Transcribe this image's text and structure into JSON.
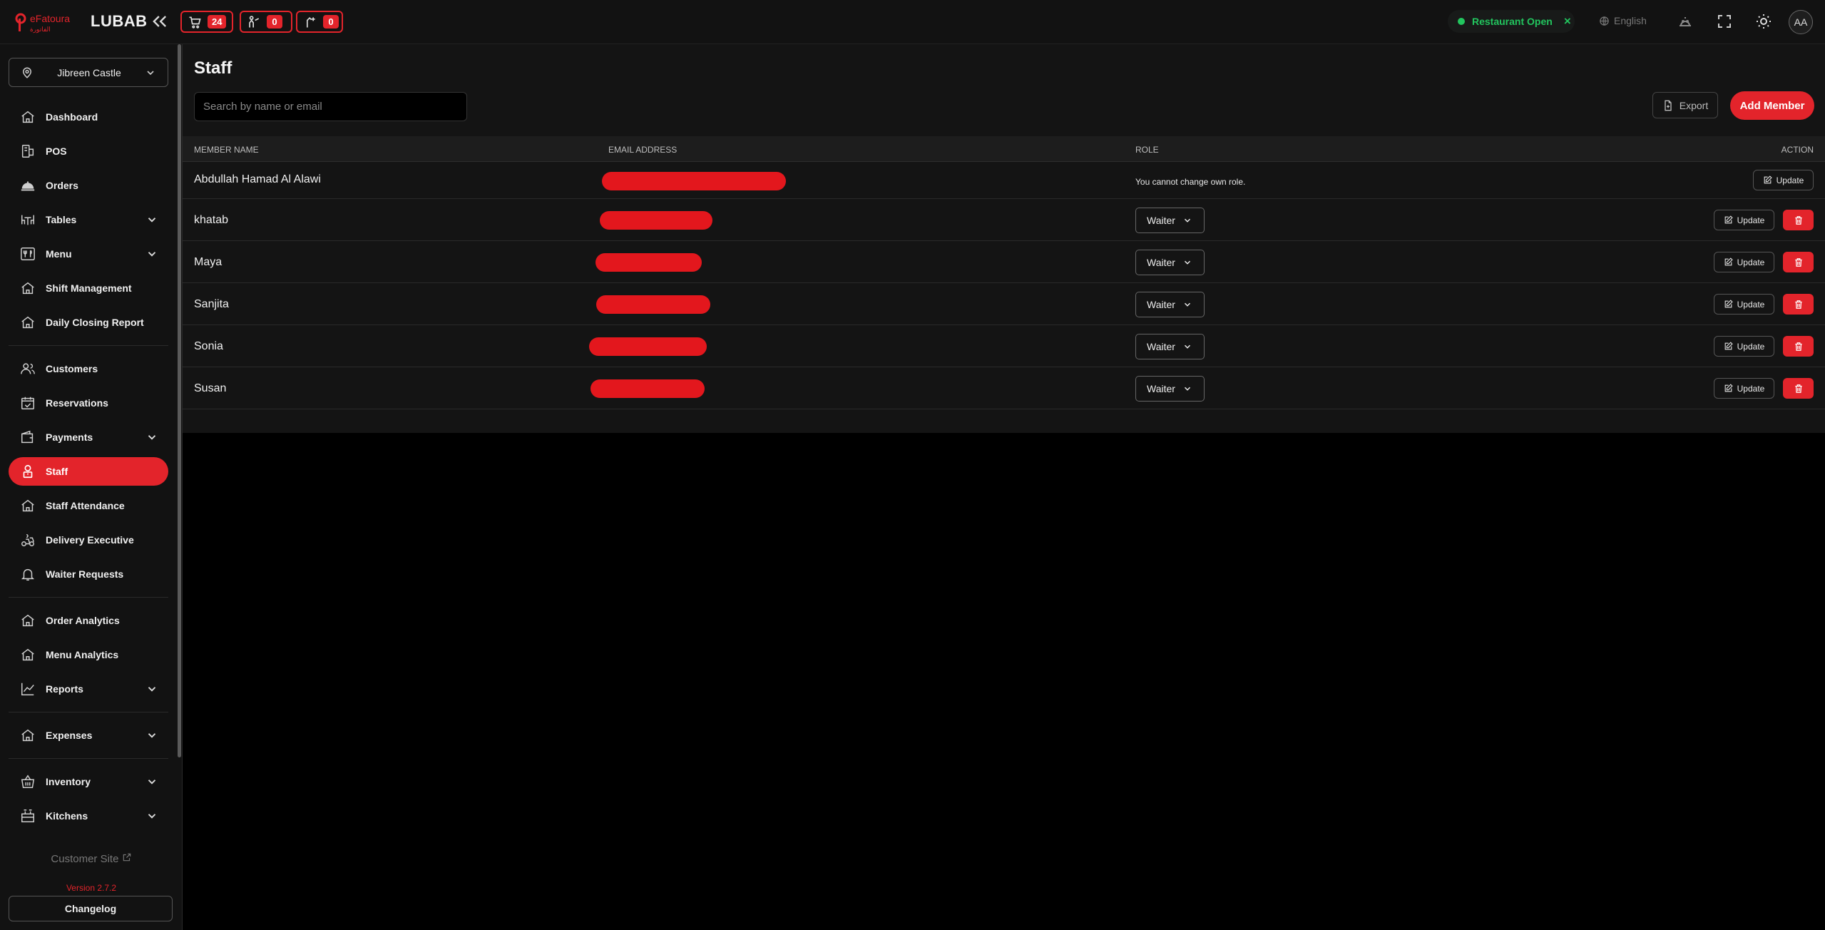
{
  "header": {
    "brand": "LUBAB",
    "logo_text": "eFatoura",
    "counters": [
      {
        "icon": "cart-icon",
        "count": "24"
      },
      {
        "icon": "waiter-call-icon",
        "count": "0"
      },
      {
        "icon": "bill-request-icon",
        "count": "0"
      }
    ],
    "status": "Restaurant Open",
    "status_close": "×",
    "language": "English",
    "avatar": "AA"
  },
  "sidebar": {
    "branch": "Jibreen Castle",
    "items": [
      {
        "label": "Dashboard",
        "icon": "home-icon"
      },
      {
        "label": "POS",
        "icon": "pos-icon"
      },
      {
        "label": "Orders",
        "icon": "cloche-icon"
      },
      {
        "label": "Tables",
        "icon": "table-icon"
      },
      {
        "label": "Menu",
        "icon": "cutlery-icon"
      },
      {
        "label": "Shift Management",
        "icon": "home-icon"
      },
      {
        "label": "Daily Closing Report",
        "icon": "home-icon"
      },
      {
        "label": "Customers",
        "icon": "users-icon"
      },
      {
        "label": "Reservations",
        "icon": "calendar-check-icon"
      },
      {
        "label": "Payments",
        "icon": "wallet-icon"
      },
      {
        "label": "Staff",
        "icon": "staff-icon"
      },
      {
        "label": "Staff Attendance",
        "icon": "home-icon"
      },
      {
        "label": "Delivery Executive",
        "icon": "scooter-icon"
      },
      {
        "label": "Waiter Requests",
        "icon": "bell-icon"
      },
      {
        "label": "Order Analytics",
        "icon": "home-icon"
      },
      {
        "label": "Menu Analytics",
        "icon": "home-icon"
      },
      {
        "label": "Reports",
        "icon": "chart-line-icon"
      },
      {
        "label": "Expenses",
        "icon": "home-icon"
      },
      {
        "label": "Inventory",
        "icon": "basket-icon"
      },
      {
        "label": "Kitchens",
        "icon": "kitchen-icon"
      }
    ],
    "customer_site": "Customer Site",
    "version": "Version 2.7.2",
    "changelog": "Changelog"
  },
  "main": {
    "title": "Staff",
    "search_placeholder": "Search by name or email",
    "export_label": "Export",
    "add_label": "Add Member",
    "columns": [
      "MEMBER NAME",
      "EMAIL ADDRESS",
      "ROLE",
      "ACTION"
    ],
    "rows": [
      {
        "name": "Abdullah Hamad Al Alawi",
        "role_note": "You cannot change own role.",
        "update": "Update"
      },
      {
        "name": "khatab",
        "role": "Waiter",
        "update": "Update"
      },
      {
        "name": "Maya",
        "role": "Waiter",
        "update": "Update"
      },
      {
        "name": "Sanjita",
        "role": "Waiter",
        "update": "Update"
      },
      {
        "name": "Sonia",
        "role": "Waiter",
        "update": "Update"
      },
      {
        "name": "Susan",
        "role": "Waiter",
        "update": "Update"
      }
    ]
  },
  "colors": {
    "accent": "#e3242b",
    "open_status": "#22c55e",
    "background": "#141414"
  }
}
